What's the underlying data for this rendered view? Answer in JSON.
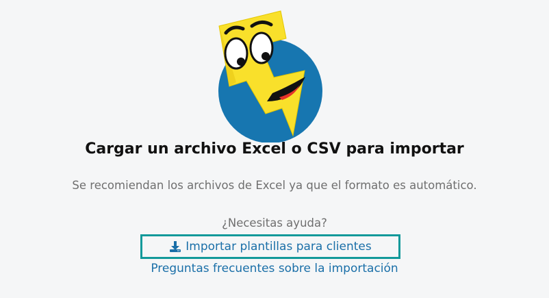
{
  "mascot": {
    "icon": "excel-mascot-icon",
    "circle_color": "#1776b0",
    "bolt_color": "#f9e02b"
  },
  "upload": {
    "title": "Cargar un archivo Excel o CSV para importar",
    "subtitle": "Se recomiendan los archivos de Excel ya que el formato es automático."
  },
  "help": {
    "question": "¿Necesitas ayuda?",
    "import_templates_link": "Importar plantillas para clientes",
    "import_templates_icon": "download-icon",
    "faq_link": "Preguntas frecuentes sobre la importación"
  },
  "colors": {
    "link": "#1a6fa8",
    "highlight_border": "#12999a"
  }
}
